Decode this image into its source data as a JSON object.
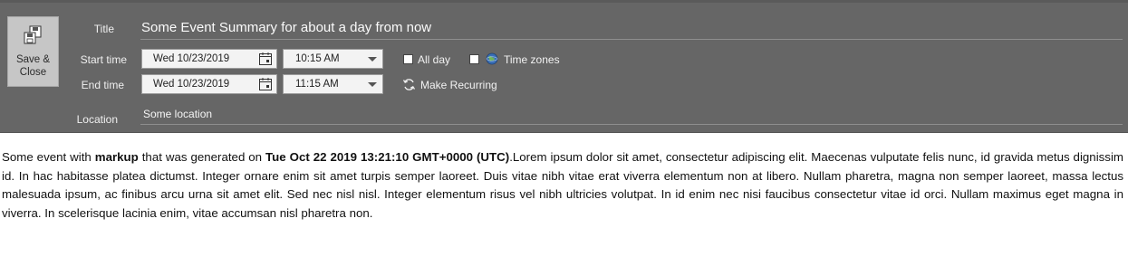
{
  "toolbar": {
    "save_close_label_line1": "Save &",
    "save_close_label_line2": "Close",
    "save_close_icon": "save-close-icon"
  },
  "form": {
    "title_label": "Title",
    "title_value": "Some Event Summary for about a day from now",
    "start_label": "Start time",
    "start_date": "Wed 10/23/2019",
    "start_time": "10:15 AM",
    "end_label": "End time",
    "end_date": "Wed 10/23/2019",
    "end_time": "11:15 AM",
    "all_day_label": "All day",
    "all_day_checked": false,
    "time_zones_label": "Time zones",
    "time_zones_checked": false,
    "make_recurring_label": "Make Recurring",
    "location_label": "Location",
    "location_value": "Some location"
  },
  "body": {
    "prefix": "Some event with ",
    "bold1": "markup",
    "middle": " that was generated on ",
    "bold2": "Tue Oct 22 2019 13:21:10 GMT+0000 (UTC)",
    "rest": ".Lorem ipsum dolor sit amet, consectetur adipiscing elit. Maecenas vulputate felis nunc, id gravida metus dignissim id. In hac habitasse platea dictumst. Integer ornare enim sit amet turpis semper laoreet. Duis vitae nibh vitae erat viverra elementum non at libero. Nullam pharetra, magna non semper laoreet, massa lectus malesuada ipsum, ac finibus arcu urna sit amet elit. Sed nec nisl nisl. Integer elementum risus vel nibh ultricies volutpat. In id enim nec nisi faucibus consectetur vitae id orci. Nullam maximus eget magna in viverra. In scelerisque lacinia enim, vitae accumsan nisl pharetra non."
  },
  "colors": {
    "header_bg": "#666666",
    "save_button_bg": "#c6c6c6",
    "input_bg": "#f3f3f3"
  }
}
